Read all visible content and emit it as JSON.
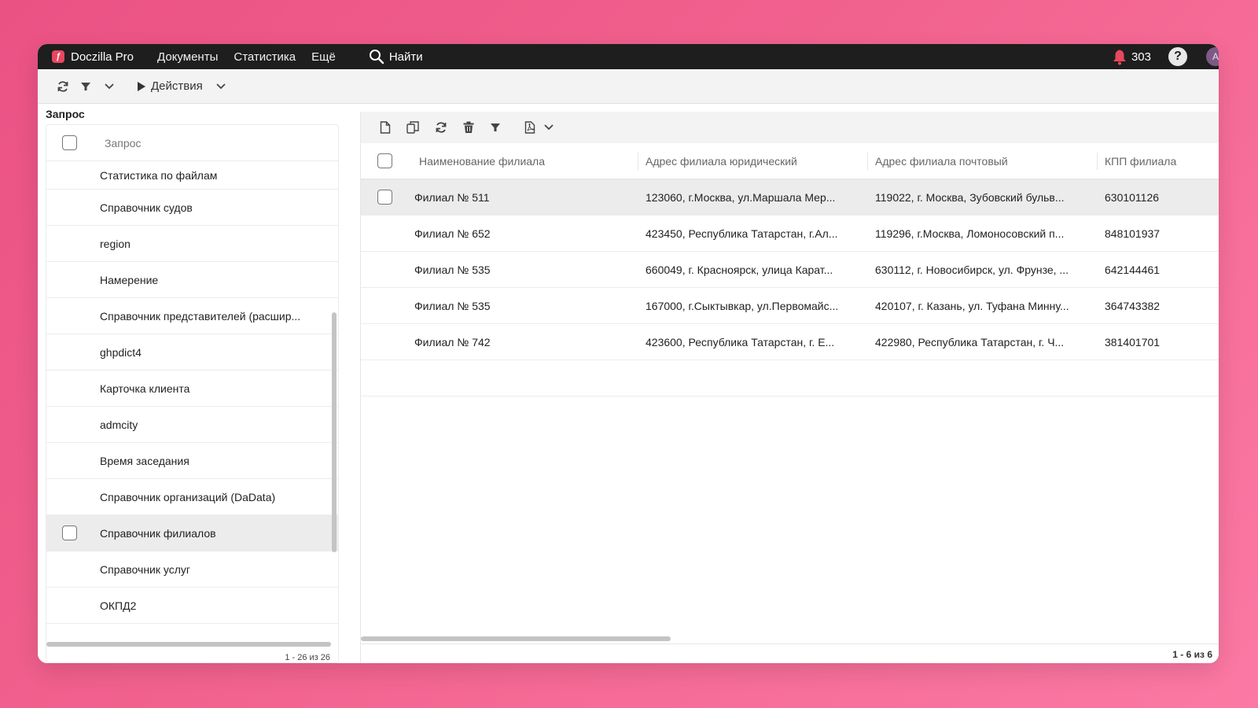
{
  "app": {
    "brand": "Doczilla Pro",
    "nav": [
      "Документы",
      "Статистика",
      "Ещё"
    ],
    "search_label": "Найти",
    "notifications_count": "303",
    "help_label": "?",
    "avatar_initial": "А"
  },
  "toolbar": {
    "actions_label": "Действия"
  },
  "left": {
    "title": "Запрос",
    "column_header": "Запрос",
    "items": [
      "Статистика по файлам",
      "Справочник судов",
      "region",
      "Намерение",
      "Справочник представителей (расшир...",
      "ghpdict4",
      "Карточка клиента",
      "admcity",
      "Время заседания",
      "Справочник организаций (DaData)",
      "Справочник филиалов",
      "Справочник услуг",
      "ОКПД2"
    ],
    "selected_index": 10,
    "footer": "1 - 26 из 26"
  },
  "grid": {
    "columns": [
      "Наименование филиала",
      "Адрес филиала юридический",
      "Адрес филиала почтовый",
      "КПП филиала"
    ],
    "rows": [
      [
        "Филиал № 511",
        "123060, г.Москва, ул.Маршала Мер...",
        "119022, г. Москва, Зубовский бульв...",
        "630101126"
      ],
      [
        "Филиал № 652",
        "423450, Республика Татарстан, г.Ал...",
        "119296, г.Москва, Ломоносовский п...",
        "848101937"
      ],
      [
        "Филиал № 535",
        "660049, г. Красноярск, улица Карат...",
        "630112, г. Новосибирск, ул. Фрунзе, ...",
        "642144461"
      ],
      [
        "Филиал № 535",
        "167000, г.Сыктывкар, ул.Первомайс...",
        "420107, г. Казань, ул. Туфана Минну...",
        "364743382"
      ],
      [
        "Филиал № 742",
        "423600, Республика Татарстан, г. Е...",
        "422980, Республика Татарстан, г. Ч...",
        "381401701"
      ]
    ],
    "selected_row": 0,
    "footer": "1 - 6 из 6"
  },
  "colors": {
    "background_start": "#ea5284",
    "background_end": "#fb79a4",
    "topbar": "#1e1e1e",
    "notification_bell": "#e8475e",
    "selected_row": "#ececec"
  }
}
